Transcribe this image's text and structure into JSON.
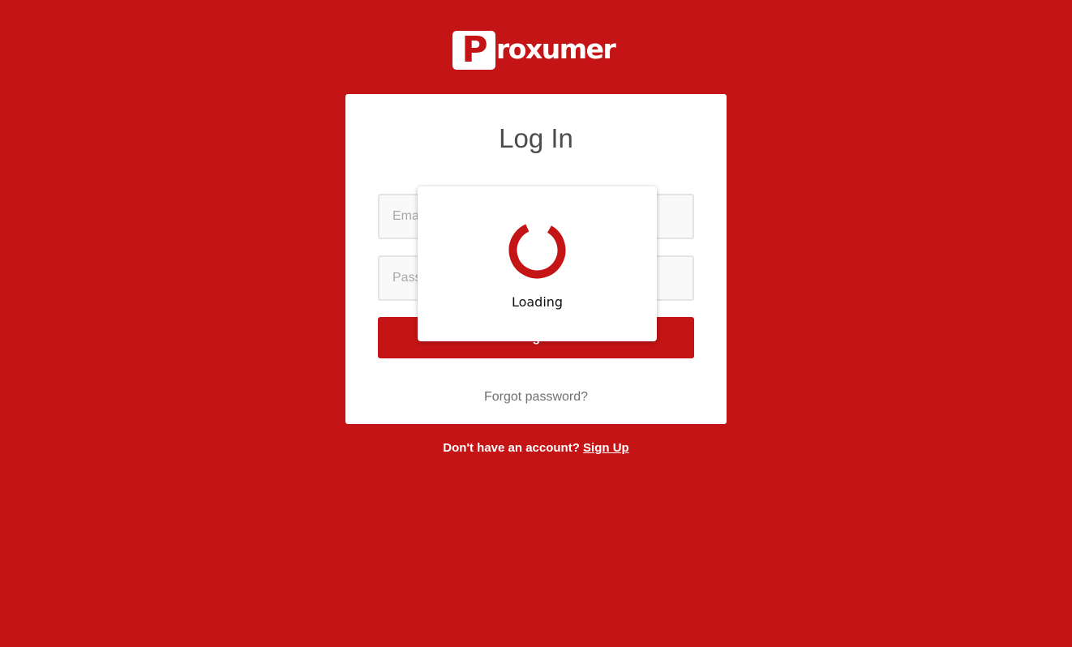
{
  "brand": {
    "logo_letter": "P",
    "logo_text": "roxumer",
    "color": "#c41416"
  },
  "login_card": {
    "title": "Log In",
    "email_placeholder": "Email",
    "password_placeholder": "Password",
    "login_button_label": "Log In",
    "forgot_password_label": "Forgot password?"
  },
  "signup": {
    "prompt": "Don't have an account?",
    "link_label": "Sign Up"
  },
  "loading_overlay": {
    "label": "Loading",
    "spinner_icon": "spinner-icon"
  }
}
